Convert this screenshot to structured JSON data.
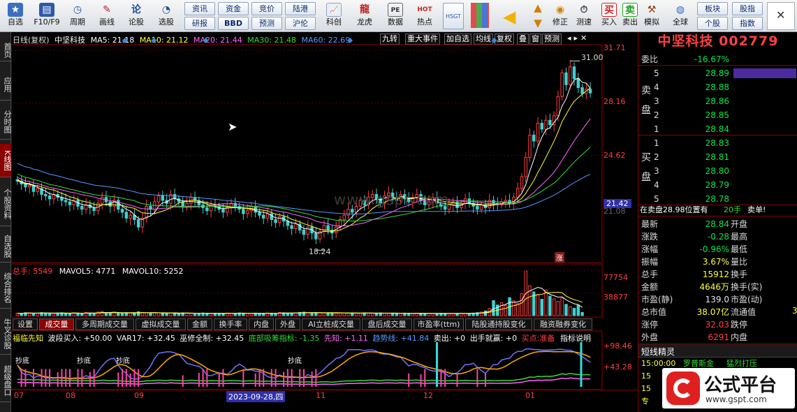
{
  "toolbar": {
    "items": [
      {
        "label": "自选",
        "icon": "star-icon"
      },
      {
        "label": "F10/F9",
        "icon": "f10-icon"
      },
      {
        "label": "周期",
        "icon": "clock-icon"
      },
      {
        "label": "画线",
        "icon": "pen-icon"
      },
      {
        "label": "论股",
        "icon": "forum-icon"
      },
      {
        "label": "选股",
        "icon": "select-icon"
      },
      {
        "label": "科创",
        "icon": "science-icon"
      },
      {
        "label": "龙虎",
        "icon": "dragon-icon"
      },
      {
        "label": "数据",
        "icon": "data-icon"
      },
      {
        "label": "热点",
        "icon": "hot-icon"
      },
      {
        "label": "修正",
        "icon": "fix-icon"
      },
      {
        "label": "测速",
        "icon": "speed-icon"
      },
      {
        "label": "买入",
        "icon": "buy-icon"
      },
      {
        "label": "卖出",
        "icon": "sell-icon"
      },
      {
        "label": "模拟",
        "icon": "simulate-icon"
      },
      {
        "label": "全球",
        "icon": "globe-icon"
      }
    ],
    "buttons": [
      "资讯",
      "资金",
      "竞价",
      "陆港",
      "研报",
      "BBD",
      "预测",
      "沪伦",
      "板块",
      "股指",
      "个股",
      "指数"
    ],
    "buy_glyph": "买",
    "sell_glyph": "卖",
    "reason_glyph": "论",
    "hsgt_glyph": "HSGT",
    "pe_glyph": "PE",
    "hot_glyph": "HOT"
  },
  "leftnav": [
    "首页",
    "应用",
    "分时图",
    "K线图",
    "个股资料",
    "自选股",
    "综合排名",
    "牛叉诊股",
    "超级盘口"
  ],
  "chart": {
    "header": {
      "type": "日线(复权)",
      "name": "中坚科技",
      "ma5": "MA5: 21.18",
      "ma10": "MA10: 21.12",
      "ma20": "MA20: 21.44",
      "ma30": "MA30: 21.48",
      "ma60": "MA60: 22.69"
    },
    "menu": [
      "九转",
      "重大事件",
      "加自选",
      "均线",
      "复权",
      "叠",
      "窗",
      "预测"
    ],
    "price_axis": [
      "31.71",
      "28.16",
      "24.62",
      "21.42",
      "21.08"
    ],
    "high_label": "31.00",
    "low_label": "18.24",
    "zhang": "涨",
    "vol_header": {
      "total": "总手: 5549",
      "mavol5": "MAVOL5: 4771",
      "mavol10": "MAVOL10: 5252"
    },
    "vol_axis": [
      "77754",
      "38877"
    ],
    "tabs": [
      "设置",
      "成交量",
      "多周期成交量",
      "虚拟成交量",
      "金额",
      "换手率",
      "内盘",
      "外盘",
      "AI立桩成交量",
      "盘后成交量",
      "市盈率(ttm)",
      "陆股通持股变化",
      "融资融券变化"
    ],
    "ind_header": {
      "a": "福临先知",
      "b": "波段买入: +50.00",
      "c": "VAR17: +32.45",
      "d": "巫修全制: +32.45",
      "e": "底部吸筹指标: -1.35",
      "f": "先知: +1.11",
      "g": "趋势线: +41.84",
      "h": "卖出: +0",
      "i": "出手就赢: +0",
      "j": "买点:准备",
      "k": "指标说明"
    },
    "ind_axis": [
      "+98.46",
      "+43.28"
    ],
    "ind_labels": [
      "抄底",
      "抄底",
      "抄底",
      "抄底"
    ],
    "dates": [
      "07",
      "08",
      "09",
      "2023-09-28,四",
      "11",
      "12",
      "01"
    ],
    "watermark": "www.gspt.com"
  },
  "chart_data": {
    "type": "candlestick",
    "title": "中坚科技",
    "y_range": [
      17.5,
      32.0
    ],
    "high": 31.0,
    "low": 18.24,
    "closes": [
      22.9,
      22.7,
      22.5,
      22.6,
      22.2,
      22.4,
      22.0,
      21.9,
      21.7,
      22.0,
      21.8,
      21.6,
      21.5,
      21.3,
      21.6,
      21.2,
      21.0,
      21.3,
      21.1,
      20.9,
      21.4,
      21.8,
      21.5,
      21.2,
      21.6,
      21.0,
      20.8,
      20.4,
      20.6,
      20.3,
      19.8,
      20.4,
      21.2,
      21.0,
      21.5,
      21.9,
      21.6,
      21.4,
      22.0,
      21.7,
      21.5,
      21.2,
      21.4,
      21.8,
      21.6,
      21.3,
      21.1,
      20.9,
      21.3,
      21.2,
      21.0,
      20.8,
      21.1,
      21.4,
      21.2,
      21.0,
      20.7,
      20.9,
      21.2,
      20.8,
      20.6,
      20.4,
      20.7,
      20.3,
      20.1,
      20.5,
      20.2,
      19.9,
      19.7,
      20.0,
      19.6,
      19.3,
      19.8,
      19.4,
      19.0,
      19.5,
      19.9,
      19.6,
      19.4,
      19.8,
      20.3,
      20.6,
      21.0,
      20.8,
      21.2,
      21.6,
      21.3,
      21.8,
      22.0,
      21.7,
      21.4,
      21.9,
      22.1,
      21.8,
      21.6,
      22.0,
      21.7,
      21.5,
      21.8,
      22.0,
      21.6,
      21.3,
      21.5,
      21.8,
      21.4,
      21.2,
      21.0,
      21.3,
      21.5,
      21.1,
      21.4,
      21.7,
      21.4,
      21.2,
      21.0,
      21.3,
      21.1,
      21.6,
      21.4,
      21.3,
      21.5,
      21.6,
      21.4,
      21.8,
      22.4,
      23.2,
      24.5,
      26.0,
      25.6,
      26.8,
      26.4,
      27.0,
      26.7,
      27.3,
      28.6,
      30.2,
      29.4,
      30.6,
      29.8,
      29.2,
      28.8,
      29.1,
      28.84
    ],
    "ma_series": [
      "MA5",
      "MA10",
      "MA20",
      "MA30",
      "MA60"
    ],
    "volume": [
      4200,
      3800,
      5100,
      4600,
      3900,
      4400,
      5200,
      4800,
      4100,
      3600,
      4500,
      5000,
      4300,
      3700,
      4900,
      4200,
      3800,
      5300,
      4600,
      4000,
      6200,
      7100,
      5400,
      4800,
      5900,
      4300,
      3900,
      5200,
      4600,
      4100,
      6800,
      5600,
      4900,
      4400,
      5100,
      4700,
      4200,
      3800,
      4600,
      4300,
      3900,
      4800,
      4500,
      4100,
      3700,
      4200,
      4600,
      4000,
      3600,
      4300,
      4100,
      3800,
      4500,
      4200,
      3900,
      4700,
      4300,
      4000,
      3700,
      4400,
      4100,
      3800,
      4600,
      4300,
      3900,
      5400,
      5000,
      4600,
      4200,
      4800,
      5600,
      6100,
      5200,
      4700,
      5300,
      4900,
      4500,
      5100,
      4800,
      4400,
      5000,
      4600,
      4200,
      4700,
      4400,
      4100,
      4800,
      4500,
      4200,
      3900,
      4600,
      4300,
      4000,
      4500,
      4200,
      3800,
      4400,
      4100,
      3700,
      4300,
      4000,
      3800,
      4200,
      3900,
      3600,
      4100,
      3800,
      3500,
      4000,
      3700,
      4300,
      4100,
      3900,
      4400,
      5200,
      6300,
      8100,
      12400,
      26000,
      18500,
      22400,
      17800,
      31200,
      25600,
      21000,
      38000,
      77754,
      52000,
      41200,
      36800,
      28400,
      44600,
      33800,
      29200,
      24800,
      30400,
      19600,
      15400,
      12800,
      18000,
      5549
    ],
    "volume_range": [
      0,
      80000
    ],
    "volume_axis_ticks": [
      77754,
      38877
    ]
  },
  "quote": {
    "title": "中坚科技 002779",
    "weibi_label": "委比",
    "weibi": "-16.67%",
    "sell_label": "卖盘",
    "buy_label": "买盘",
    "asks": [
      {
        "n": "5",
        "p": "28.89"
      },
      {
        "n": "4",
        "p": "28.88"
      },
      {
        "n": "3",
        "p": "28.86"
      },
      {
        "n": "2",
        "p": "28.85"
      },
      {
        "n": "1",
        "p": "28.84"
      }
    ],
    "bids": [
      {
        "n": "1",
        "p": "28.83"
      },
      {
        "n": "2",
        "p": "28.81"
      },
      {
        "n": "3",
        "p": "28.80"
      },
      {
        "n": "4",
        "p": "28.79"
      },
      {
        "n": "5",
        "p": "28.78"
      }
    ],
    "info": "在卖盘28.98位置有",
    "info_qty": "20手",
    "info_act": "卖单!",
    "stats": [
      {
        "l": "最新",
        "v": "28.84",
        "c": "gr",
        "l2": "开盘"
      },
      {
        "l": "涨跌",
        "v": "-0.28",
        "c": "gr",
        "l2": "最高"
      },
      {
        "l": "涨幅",
        "v": "-0.96%",
        "c": "gr",
        "l2": "最低"
      },
      {
        "l": "振幅",
        "v": "3.67%",
        "c": "yl",
        "l2": "量比"
      },
      {
        "l": "总手",
        "v": "15912",
        "c": "yl",
        "l2": "换手"
      },
      {
        "l": "金额",
        "v": "4646万",
        "c": "yl",
        "l2": "换手(实)"
      },
      {
        "l": "市盈(静)",
        "v": "139.0",
        "c": "wh",
        "l2": "市盈(动)"
      },
      {
        "l": "总市值",
        "v": "38.07亿",
        "c": "yl",
        "l2": "流通值"
      },
      {
        "l": "涨停",
        "v": "32.03",
        "c": "rd",
        "l2": "跌停"
      },
      {
        "l": "外盘",
        "v": "6291",
        "c": "rd",
        "l2": "内盘"
      }
    ],
    "extra_digit": "3",
    "sprite_title": "短线精灵",
    "sprite": [
      {
        "t": "15:00:00",
        "a": "罗普斯金",
        "b": "猛烈打压"
      },
      {
        "t": "15",
        "a": "",
        "b": ""
      },
      {
        "t": "15",
        "a": "",
        "b": ""
      },
      {
        "t": "专",
        "a": "",
        "b": ""
      }
    ]
  },
  "badge": {
    "brand": "公式平台",
    "url": "www.gspt.com"
  }
}
